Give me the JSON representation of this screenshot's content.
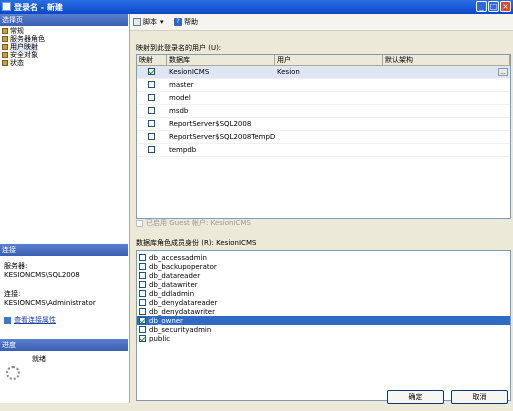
{
  "window": {
    "title": "登录名 - 新建",
    "controls": [
      "minimize-icon",
      "maximize-icon",
      "close-icon"
    ]
  },
  "sidebar": {
    "pages_header": "选择页",
    "pages": [
      {
        "label": "常规",
        "selected": false
      },
      {
        "label": "服务器角色",
        "selected": false
      },
      {
        "label": "用户映射",
        "selected": true
      },
      {
        "label": "安全对象",
        "selected": false
      },
      {
        "label": "状态",
        "selected": false
      }
    ],
    "connection_header": "连接",
    "server_label": "服务器:",
    "server_value": "KESIONCMS\\SQL2008",
    "connection_label": "连接:",
    "connection_value": "KESIONCMS\\Administrator",
    "view_props_link": "查看连接属性",
    "progress_header": "进度",
    "progress_status": "就绪"
  },
  "toolbar": {
    "script_label": "脚本",
    "help_label": "帮助"
  },
  "users_section": {
    "caption": "映射到此登录名的用户 (U):",
    "columns": [
      "映射",
      "数据库",
      "用户",
      "默认架构"
    ],
    "rows": [
      {
        "mapped": true,
        "database": "KesionICMS",
        "user": "Kesion",
        "schema": "",
        "selected": true
      },
      {
        "mapped": false,
        "database": "master",
        "user": "",
        "schema": "",
        "selected": false
      },
      {
        "mapped": false,
        "database": "model",
        "user": "",
        "schema": "",
        "selected": false
      },
      {
        "mapped": false,
        "database": "msdb",
        "user": "",
        "schema": "",
        "selected": false
      },
      {
        "mapped": false,
        "database": "ReportServer$SQL2008",
        "user": "",
        "schema": "",
        "selected": false
      },
      {
        "mapped": false,
        "database": "ReportServer$SQL2008TempDB",
        "user": "",
        "schema": "",
        "selected": false
      },
      {
        "mapped": false,
        "database": "tempdb",
        "user": "",
        "schema": "",
        "selected": false
      }
    ]
  },
  "guest_checkbox": {
    "label": "已启用 Guest 帐户: KesionICMS",
    "checked": false,
    "disabled": true
  },
  "roles_section": {
    "caption": "数据库角色成员身份 (R): KesionICMS",
    "roles": [
      {
        "name": "db_accessadmin",
        "checked": false,
        "highlighted": false
      },
      {
        "name": "db_backupoperator",
        "checked": false,
        "highlighted": false
      },
      {
        "name": "db_datareader",
        "checked": false,
        "highlighted": false
      },
      {
        "name": "db_datawriter",
        "checked": false,
        "highlighted": false
      },
      {
        "name": "db_ddladmin",
        "checked": false,
        "highlighted": false
      },
      {
        "name": "db_denydatareader",
        "checked": false,
        "highlighted": false
      },
      {
        "name": "db_denydatawriter",
        "checked": false,
        "highlighted": false
      },
      {
        "name": "db_owner",
        "checked": true,
        "highlighted": true
      },
      {
        "name": "db_securityadmin",
        "checked": false,
        "highlighted": false
      },
      {
        "name": "public",
        "checked": true,
        "highlighted": false
      }
    ]
  },
  "buttons": {
    "ok": "确定",
    "cancel": "取消"
  }
}
